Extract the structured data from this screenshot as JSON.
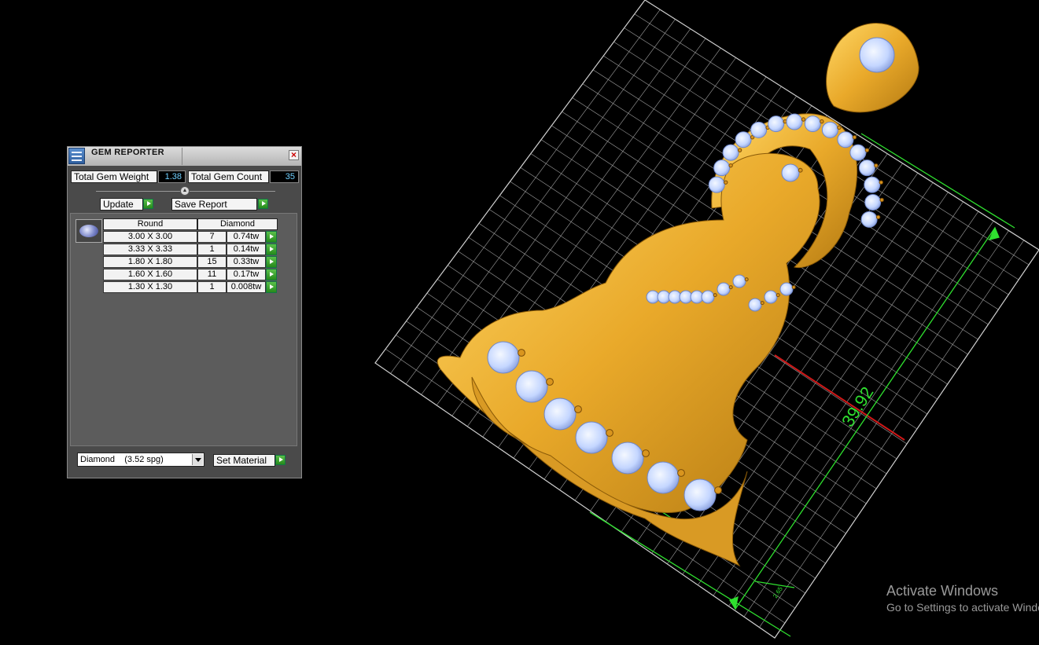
{
  "panel": {
    "title": "GEM REPORTER",
    "total_weight_label": "Total Gem Weight",
    "total_weight_value": "1.38",
    "total_count_label": "Total Gem Count",
    "total_count_value": "35",
    "update_label": "Update",
    "save_report_label": "Save Report",
    "table": {
      "col_shape": "Round",
      "col_material": "Diamond",
      "rows": [
        {
          "size": "3.00 X 3.00",
          "count": "7",
          "weight": "0.74tw"
        },
        {
          "size": "3.33 X 3.33",
          "count": "1",
          "weight": "0.14tw"
        },
        {
          "size": "1.80 X 1.80",
          "count": "15",
          "weight": "0.33tw"
        },
        {
          "size": "1.60 X 1.60",
          "count": "11",
          "weight": "0.17tw"
        },
        {
          "size": "1.30 X 1.30",
          "count": "1",
          "weight": "0.008tw"
        }
      ]
    },
    "material_select": "Diamond    (3.52 spg)",
    "set_material_label": "Set Material"
  },
  "viewport": {
    "dimension_label": "39.92",
    "small_dimension_label": "2.65",
    "colors": {
      "background": "#000000",
      "gold": "#f2b635",
      "gem": "#bcd2ff",
      "grid": "#c8c8c8",
      "dimension": "#2fe02f",
      "axis": "#d01818"
    }
  },
  "watermark": {
    "line1": "Activate Windows",
    "line2": "Go to Settings to activate Windows."
  }
}
